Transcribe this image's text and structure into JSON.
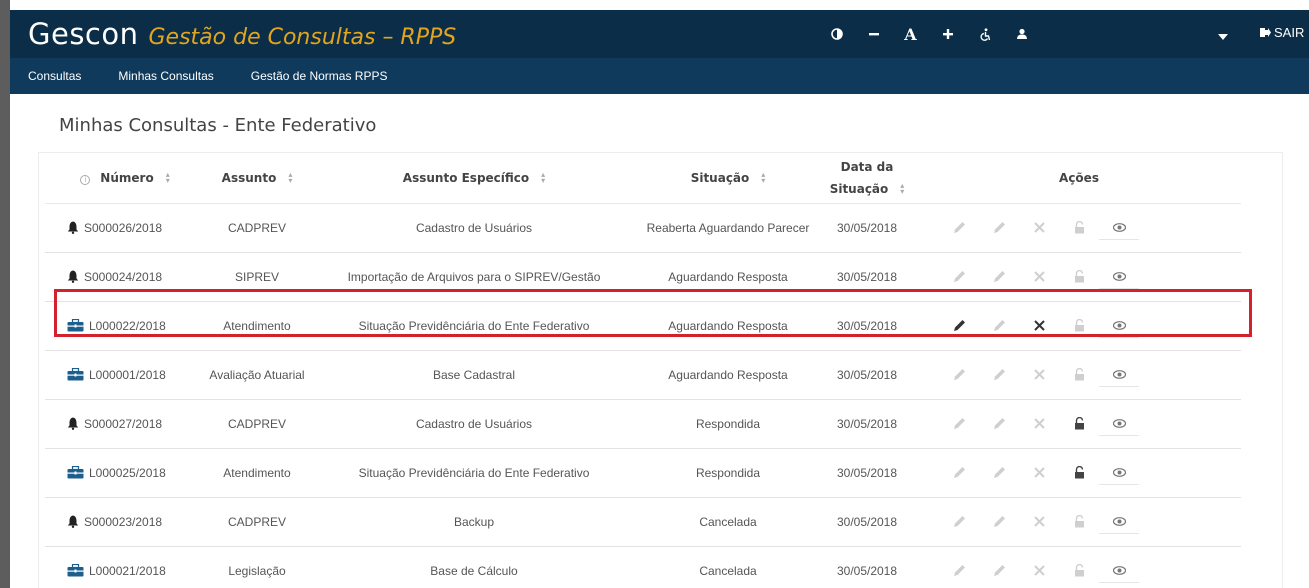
{
  "header": {
    "brand": "Gescon",
    "subtitle": "Gestão de Consultas – RPPS",
    "tools": [
      "contrast-icon",
      "decrease-font-icon",
      "font-icon",
      "increase-font-icon",
      "accessibility-icon",
      "user-icon"
    ],
    "font_label": "A",
    "logout_label": "SAIR"
  },
  "menu": {
    "items": [
      "Consultas",
      "Minhas Consultas",
      "Gestão de Normas RPPS"
    ]
  },
  "page": {
    "title": "Minhas Consultas - Ente Federativo"
  },
  "table": {
    "headers": {
      "numero": "Número",
      "assunto": "Assunto",
      "especifico": "Assunto Específico",
      "situacao": "Situação",
      "data_line1": "Data da",
      "data_line2": "Situação",
      "acoes": "Ações"
    },
    "rows": [
      {
        "icon": "bell-icon",
        "numero": "S000026/2018",
        "assunto": "CADPREV",
        "especifico": "Cadastro de Usuários",
        "situacao": "Reaberta Aguardando Parecer",
        "data": "30/05/2018",
        "edit": false,
        "edit2": false,
        "cancel": false,
        "lock": false
      },
      {
        "icon": "bell-icon",
        "numero": "S000024/2018",
        "assunto": "SIPREV",
        "especifico": "Importação de Arquivos para o SIPREV/Gestão",
        "situacao": "Aguardando Resposta",
        "data": "30/05/2018",
        "edit": false,
        "edit2": false,
        "cancel": false,
        "lock": false
      },
      {
        "icon": "briefcase-icon",
        "numero": "L000022/2018",
        "assunto": "Atendimento",
        "especifico": "Situação Previdênciária do Ente Federativo",
        "situacao": "Aguardando Resposta",
        "data": "30/05/2018",
        "edit": true,
        "edit2": false,
        "cancel": true,
        "lock": false
      },
      {
        "icon": "briefcase-icon",
        "numero": "L000001/2018",
        "assunto": "Avaliação Atuarial",
        "especifico": "Base Cadastral",
        "situacao": "Aguardando Resposta",
        "data": "30/05/2018",
        "edit": false,
        "edit2": false,
        "cancel": false,
        "lock": false
      },
      {
        "icon": "bell-icon",
        "numero": "S000027/2018",
        "assunto": "CADPREV",
        "especifico": "Cadastro de Usuários",
        "situacao": "Respondida",
        "data": "30/05/2018",
        "edit": false,
        "edit2": false,
        "cancel": false,
        "lock": true
      },
      {
        "icon": "briefcase-icon",
        "numero": "L000025/2018",
        "assunto": "Atendimento",
        "especifico": "Situação Previdênciária do Ente Federativo",
        "situacao": "Respondida",
        "data": "30/05/2018",
        "edit": false,
        "edit2": false,
        "cancel": false,
        "lock": true
      },
      {
        "icon": "bell-icon",
        "numero": "S000023/2018",
        "assunto": "CADPREV",
        "especifico": "Backup",
        "situacao": "Cancelada",
        "data": "30/05/2018",
        "edit": false,
        "edit2": false,
        "cancel": false,
        "lock": false
      },
      {
        "icon": "briefcase-icon",
        "numero": "L000021/2018",
        "assunto": "Legislação",
        "especifico": "Base de Cálculo",
        "situacao": "Cancelada",
        "data": "30/05/2018",
        "edit": false,
        "edit2": false,
        "cancel": false,
        "lock": false
      }
    ]
  },
  "colors": {
    "topbar": "#0b2d47",
    "menubar": "#0f3a5c",
    "brand_sub": "#e3a51c",
    "highlight": "#d4212e",
    "icon_active": "#333333",
    "icon_disabled": "#cfcfcf"
  }
}
